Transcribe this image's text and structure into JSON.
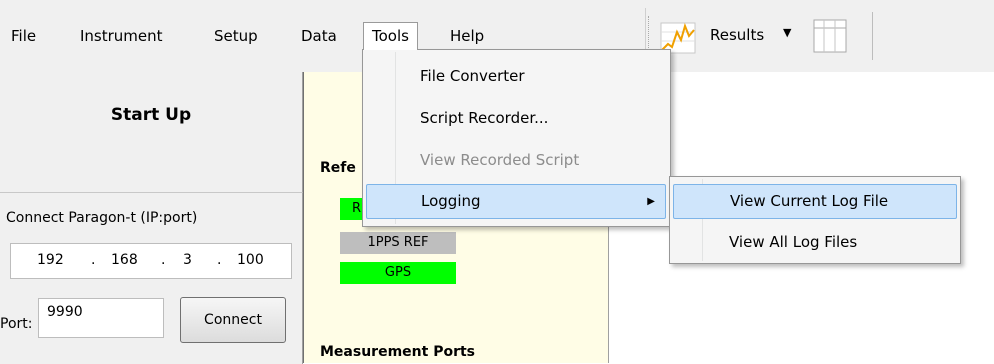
{
  "menubar": {
    "items": [
      "File",
      "Instrument",
      "Setup",
      "Data",
      "Tools",
      "Help"
    ],
    "active": "Tools"
  },
  "toolbar": {
    "results_label": "Results",
    "results_icon": "chart-icon",
    "grid_icon": "grid-icon"
  },
  "startup": {
    "title": "Start Up"
  },
  "connect": {
    "label": "Connect Paragon-t (IP:port)",
    "ip": [
      "192",
      ".",
      "168",
      ".",
      "3",
      ".",
      "100"
    ],
    "port_label": "Port:",
    "port_value": "9990",
    "button_label": "Connect"
  },
  "middle": {
    "reference_title": "Refe",
    "ref_items": [
      "R",
      "1PPS REF",
      "GPS"
    ],
    "measurement_title": "Measurement Ports"
  },
  "tools_menu": {
    "items": [
      {
        "label": "File Converter",
        "disabled": false
      },
      {
        "label": "Script Recorder...",
        "disabled": false
      },
      {
        "label": "View Recorded Script",
        "disabled": true
      },
      {
        "label": "Logging",
        "disabled": false,
        "submenu": true,
        "highlighted": true
      }
    ]
  },
  "logging_submenu": {
    "items": [
      {
        "label": "View Current Log File",
        "highlighted": true
      },
      {
        "label": "View All Log Files",
        "highlighted": false
      }
    ]
  },
  "colors": {
    "green": "#00ff00",
    "gray": "#bebebe",
    "panel_yellow": "#fffde6",
    "highlight": "#cfe5fb"
  }
}
